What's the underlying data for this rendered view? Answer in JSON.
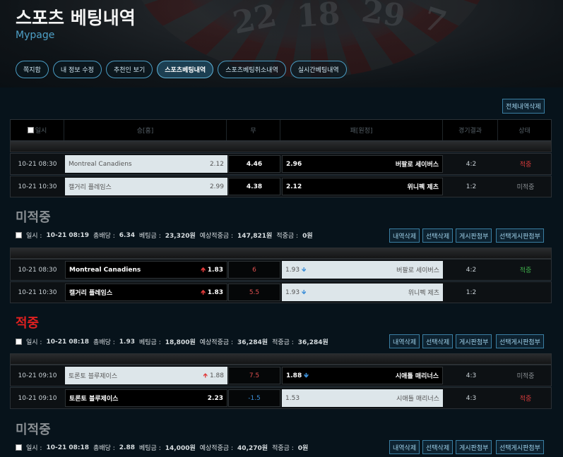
{
  "header": {
    "title": "스포츠 베팅내역",
    "subtitle": "Mypage",
    "bg_numbers": [
      "22",
      "18",
      "29",
      "7"
    ],
    "tabs": [
      {
        "label": "쪽지함",
        "active": false
      },
      {
        "label": "내 정보 수정",
        "active": false
      },
      {
        "label": "추천인 보기",
        "active": false
      },
      {
        "label": "스포츠베팅내역",
        "active": true
      },
      {
        "label": "스포츠베팅취소내역",
        "active": false
      },
      {
        "label": "실시간베팅내역",
        "active": false
      }
    ]
  },
  "toolbar": {
    "delete_all_label": "전체내역삭제"
  },
  "table_header": {
    "date": "일시",
    "home": "승[홈]",
    "draw": "무",
    "away": "패[원정]",
    "result": "경기결과",
    "status": "상태"
  },
  "groups": [
    {
      "rows": [
        {
          "date": "10-21 08:30",
          "home": "Montreal Canadiens",
          "home_odds": "2.12",
          "draw": "4.46",
          "away_odds": "2.96",
          "away": "버팔로 세이버스",
          "result": "4:2",
          "status": "적중"
        },
        {
          "date": "10-21 10:30",
          "home": "캘거리 플레임스",
          "home_odds": "2.99",
          "draw": "4.38",
          "away_odds": "2.12",
          "away": "위니펙 제츠",
          "result": "1:2",
          "status": "미적중"
        }
      ]
    },
    {
      "title": "미적중",
      "title_color": "#8a8f93",
      "info": {
        "date_label": "일시 :",
        "date": "10-21 08:19",
        "odds_label": "총배당 :",
        "odds": "6.34",
        "bet_label": "베팅금 :",
        "bet": "23,320원",
        "expected_label": "예상적중금 :",
        "expected": "147,821원",
        "won_label": "적중금 :",
        "won": "0원"
      },
      "buttons": [
        "내역삭제",
        "선택삭제",
        "게시판첨부",
        "선택게시판첨부"
      ],
      "rows": [
        {
          "date": "10-21 08:30",
          "home": "Montreal Canadiens",
          "home_odds": "1.83",
          "draw": "6",
          "away_odds": "1.93",
          "away": "버팔로 세이버스",
          "result": "4:2",
          "status": "적중"
        },
        {
          "date": "10-21 10:30",
          "home": "캘거리 플레임스",
          "home_odds": "1.83",
          "draw": "5.5",
          "away_odds": "1.93",
          "away": "위니펙 제츠",
          "result": "1:2",
          "status": ""
        }
      ]
    },
    {
      "title": "적중",
      "title_color": "#e02020",
      "info": {
        "date_label": "일시 :",
        "date": "10-21 08:18",
        "odds_label": "총배당 :",
        "odds": "1.93",
        "bet_label": "베팅금 :",
        "bet": "18,800원",
        "expected_label": "예상적중금 :",
        "expected": "36,284원",
        "won_label": "적중금 :",
        "won": "36,284원"
      },
      "buttons": [
        "내역삭제",
        "선택삭제",
        "게시판첨부",
        "선택게시판첨부"
      ],
      "rows": [
        {
          "date": "10-21 09:10",
          "home": "토론토 블루제이스",
          "home_odds": "1.88",
          "draw": "7.5",
          "away_odds": "1.88",
          "away": "시애틀 매리너스",
          "result": "4:3",
          "status": "미적중"
        },
        {
          "date": "10-21 09:10",
          "home": "토론토 블루제이스",
          "home_odds": "2.23",
          "draw": "-1.5",
          "away_odds": "1.53",
          "away": "시애틀 매리너스",
          "result": "4:3",
          "status": "적중"
        }
      ]
    },
    {
      "title": "미적중",
      "title_color": "#8a8f93",
      "info": {
        "date_label": "일시 :",
        "date": "10-21 08:18",
        "odds_label": "총배당 :",
        "odds": "2.88",
        "bet_label": "베팅금 :",
        "bet": "14,000원",
        "expected_label": "예상적중금 :",
        "expected": "40,270원",
        "won_label": "적중금 :",
        "won": "0원"
      },
      "buttons": [
        "내역삭제",
        "선택삭제",
        "게시판첨부",
        "선택게시판첨부"
      ],
      "rows": []
    }
  ],
  "colors": {
    "accent": "#4ea0c7",
    "hit": "#d63b3b",
    "hit_green": "#3fae4a",
    "miss": "#8a8f93",
    "odds_up": "#e03a3a",
    "odds_down": "#3c8fd8"
  }
}
